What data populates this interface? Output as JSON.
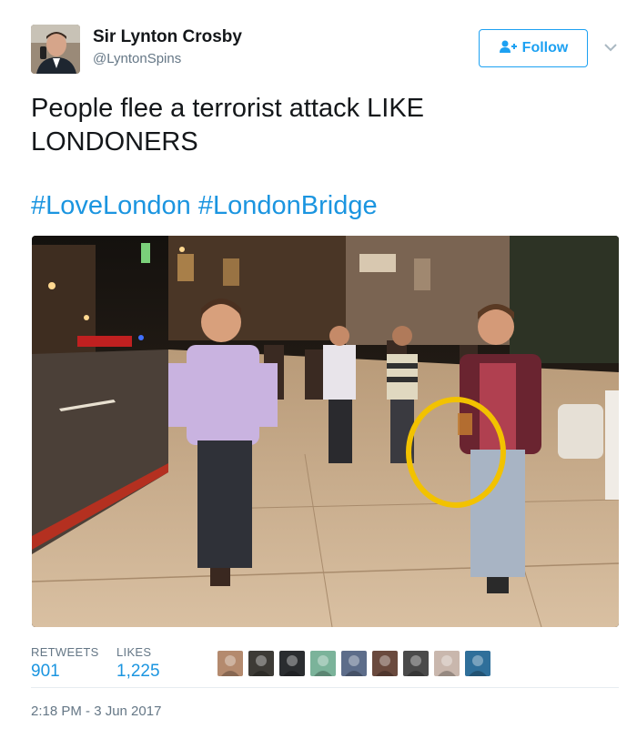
{
  "author": {
    "name": "Sir Lynton Crosby",
    "handle": "@LyntonSpins",
    "follow_label": "Follow"
  },
  "tweet": {
    "text": "People flee a terrorist attack LIKE LONDONERS",
    "hashtags": [
      "#LoveLondon",
      "#LondonBridge"
    ]
  },
  "stats": {
    "retweets_label": "RETWEETS",
    "retweets_value": "901",
    "likes_label": "LIKES",
    "likes_value": "1,225"
  },
  "timestamp": "2:18 PM - 3 Jun 2017",
  "likers": [
    {
      "color": "#b48a6e"
    },
    {
      "color": "#3d3b36"
    },
    {
      "color": "#2a2d30"
    },
    {
      "color": "#7bb39a"
    },
    {
      "color": "#5d6d8a"
    },
    {
      "color": "#6a4a3e"
    },
    {
      "color": "#4a4a4a"
    },
    {
      "color": "#c9b7ad"
    },
    {
      "color": "#2f6f9a"
    }
  ],
  "colors": {
    "link": "#1b95e0",
    "follow_border": "#1da1f2",
    "annotation_circle": "#f2c200"
  }
}
